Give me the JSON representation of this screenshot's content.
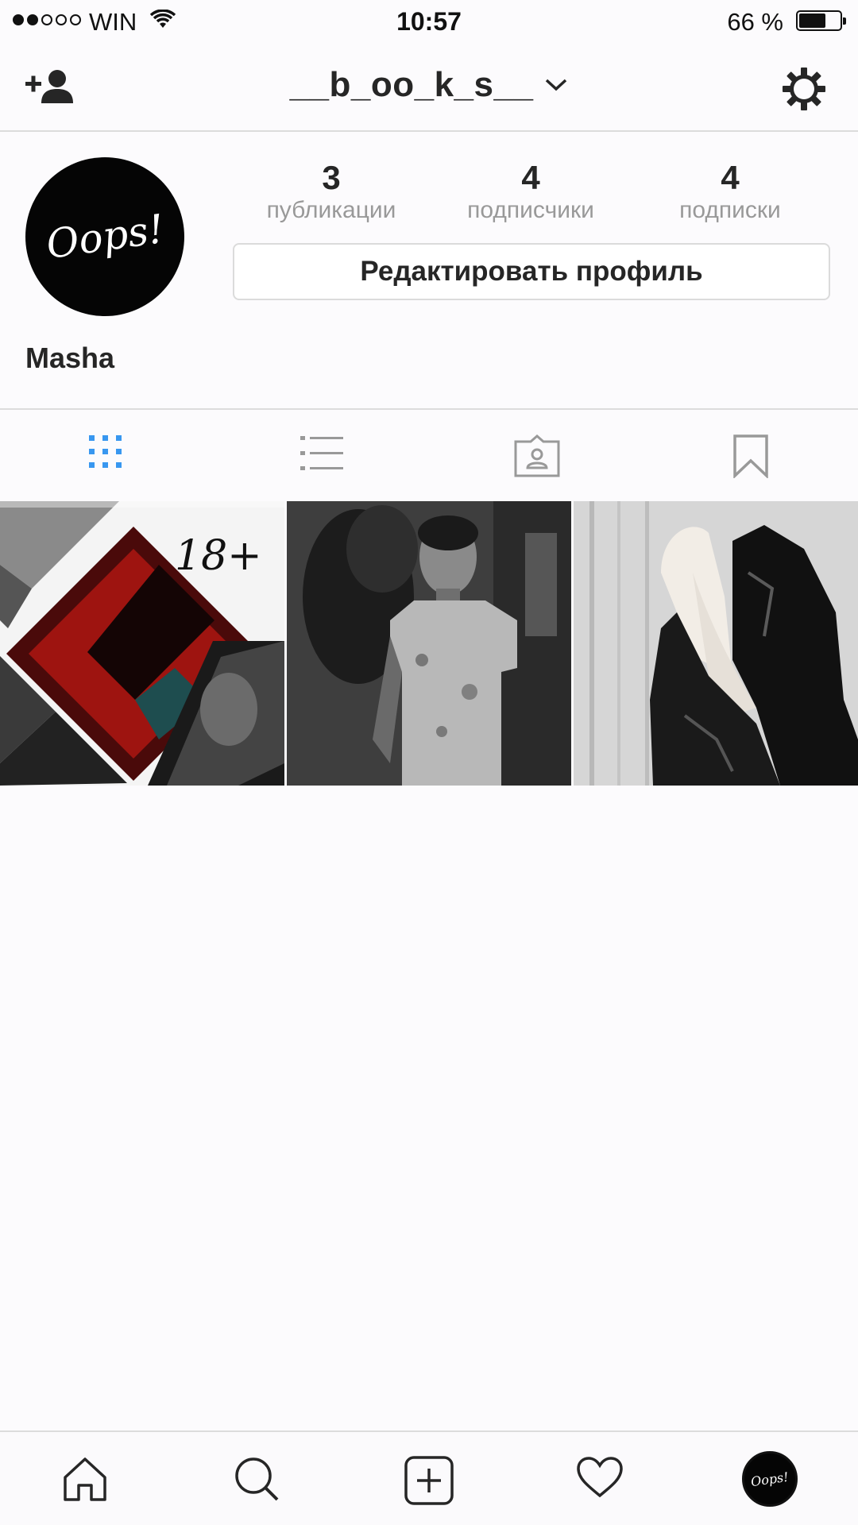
{
  "status_bar": {
    "carrier": "WIN",
    "time": "10:57",
    "battery": "66 %",
    "battery_level": 0.66,
    "signal_bars": 2,
    "signal_total": 5
  },
  "header": {
    "username": "__b_oo_k_s__",
    "icons": [
      "add-user-icon",
      "chevron-down-icon",
      "gear-icon"
    ]
  },
  "profile": {
    "avatar_text": "Oops!",
    "display_name": "Masha",
    "stats": [
      {
        "value": "3",
        "label": "публикации"
      },
      {
        "value": "4",
        "label": "подписчики"
      },
      {
        "value": "4",
        "label": "подписки"
      }
    ],
    "edit_button": "Редактировать профиль"
  },
  "tabs": {
    "active": "grid",
    "icons": [
      "grid-icon",
      "list-icon",
      "tagged-icon",
      "bookmark-icon"
    ],
    "active_color": "#3897f0"
  },
  "posts": [
    {
      "overlay_text": "18+"
    },
    {},
    {}
  ],
  "bottom_nav": {
    "icons": [
      "home-icon",
      "search-icon",
      "add-post-icon",
      "heart-icon",
      "profile-avatar-icon"
    ],
    "avatar_text": "Oops!"
  }
}
